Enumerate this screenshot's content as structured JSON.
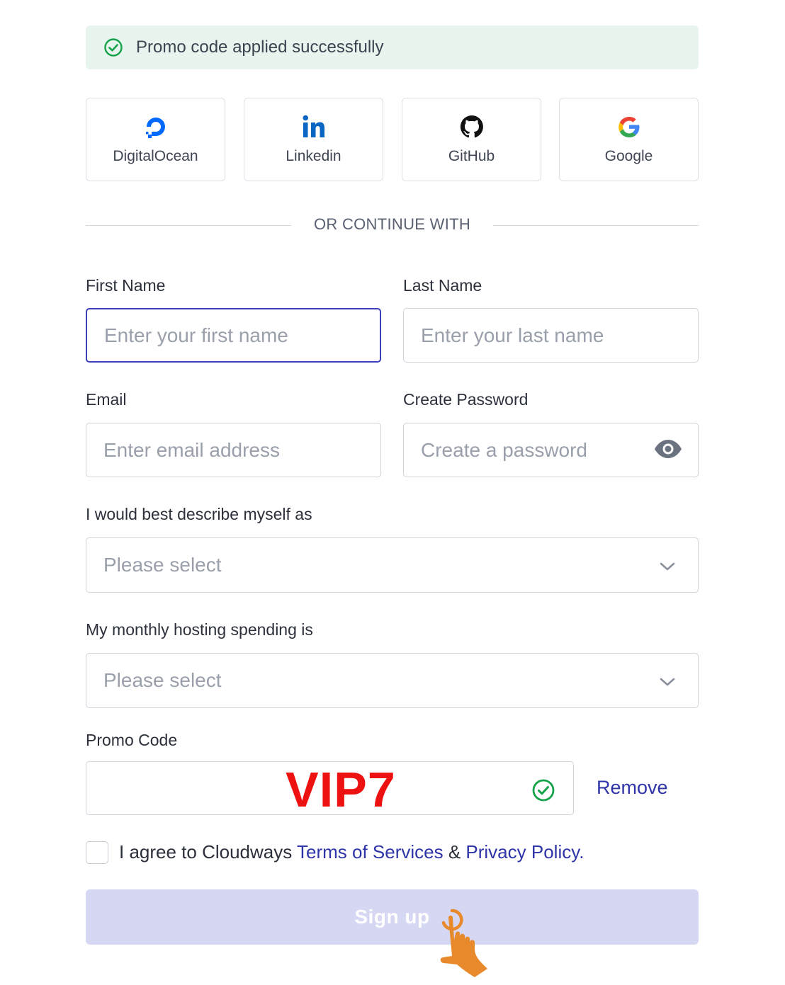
{
  "alert": {
    "message": "Promo code applied successfully",
    "icon": "check-circle-icon",
    "color": "#16a34a"
  },
  "social": [
    {
      "label": "DigitalOcean",
      "icon": "digitalocean-icon",
      "color": "#0069ff"
    },
    {
      "label": "Linkedin",
      "icon": "linkedin-icon",
      "color": "#0a66c2"
    },
    {
      "label": "GitHub",
      "icon": "github-icon",
      "color": "#111111"
    },
    {
      "label": "Google",
      "icon": "google-icon",
      "color": "#4285f4"
    }
  ],
  "divider_text": "OR CONTINUE WITH",
  "form": {
    "first_name": {
      "label": "First Name",
      "placeholder": "Enter your first name",
      "value": ""
    },
    "last_name": {
      "label": "Last Name",
      "placeholder": "Enter your last name",
      "value": ""
    },
    "email": {
      "label": "Email",
      "placeholder": "Enter email address",
      "value": ""
    },
    "password": {
      "label": "Create Password",
      "placeholder": "Create a password",
      "value": "",
      "toggle_icon": "eye-icon"
    },
    "describe": {
      "label": "I would best describe myself as",
      "selected": "Please select"
    },
    "spending": {
      "label": "My monthly hosting spending is",
      "selected": "Please select"
    },
    "promo": {
      "label": "Promo Code",
      "value": "VIP7",
      "remove_label": "Remove",
      "status_icon": "check-circle-icon"
    }
  },
  "agreement": {
    "prefix": "I agree to Cloudways ",
    "terms": "Terms of Services",
    "and": " & ",
    "privacy": "Privacy Policy."
  },
  "signup_label": "Sign up",
  "colors": {
    "accent": "#2f35a8",
    "promo_text": "#ee1111",
    "success": "#16a34a",
    "signup_bg": "#d6d7f3"
  }
}
